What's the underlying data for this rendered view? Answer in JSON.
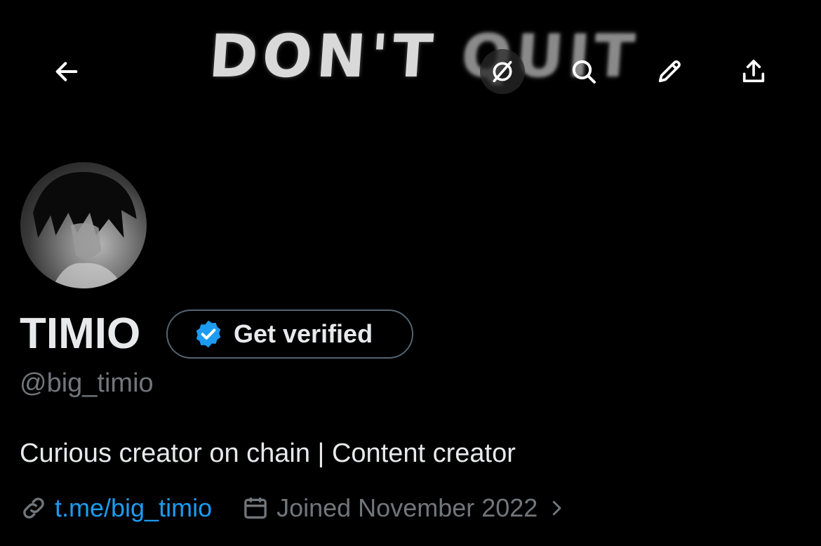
{
  "banner": {
    "text_a": "DON'T",
    "text_b": "QUIT"
  },
  "toolbar": {
    "back_icon": "arrow-left-icon",
    "grok_icon": "grok-icon",
    "search_icon": "search-icon",
    "edit_icon": "pencil-icon",
    "share_icon": "share-upload-icon"
  },
  "profile": {
    "display_name": "TIMIO",
    "verify_label": "Get verified",
    "handle": "@big_timio",
    "bio": "Curious creator on chain | Content creator",
    "website": "t.me/big_timio",
    "joined": "Joined November 2022"
  },
  "colors": {
    "accent": "#1d9bf0",
    "muted": "#71767b",
    "text": "#e7e9ea",
    "background": "#000000"
  }
}
